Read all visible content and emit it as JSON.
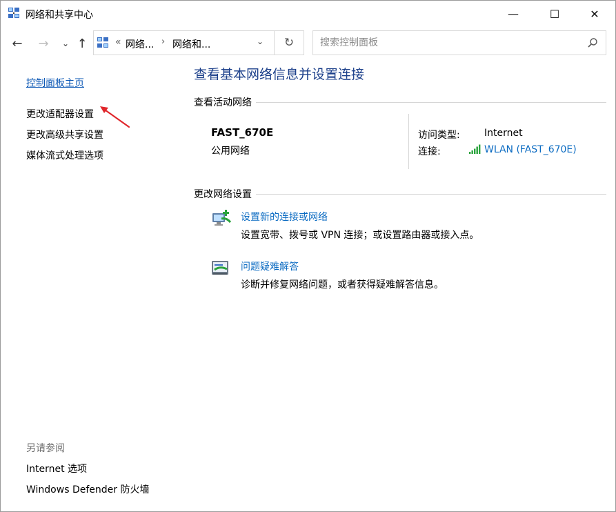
{
  "window": {
    "title": "网络和共享中心",
    "controls": {
      "minimize": "—",
      "maximize": "☐",
      "close": "✕"
    }
  },
  "nav": {
    "back": "←",
    "forward": "→",
    "recent": "⌄",
    "up": "↑",
    "breadcrumb_chevron": "«",
    "breadcrumb": [
      "网络...",
      "网络和..."
    ],
    "breadcrumb_separator": "›",
    "dropdown": "⌄",
    "refresh": "↻",
    "search_placeholder": "搜索控制面板"
  },
  "left_pane": {
    "home": "控制面板主页",
    "links": [
      "更改适配器设置",
      "更改高级共享设置",
      "媒体流式处理选项"
    ],
    "see_also_header": "另请参阅",
    "see_also": [
      "Internet 选项",
      "Windows Defender 防火墙"
    ]
  },
  "main": {
    "title": "查看基本网络信息并设置连接",
    "active_networks_header": "查看活动网络",
    "network": {
      "name": "FAST_670E",
      "type": "公用网络",
      "access_type_label": "访问类型:",
      "access_type_value": "Internet",
      "connection_label": "连接:",
      "connection_value": "WLAN (FAST_670E)"
    },
    "change_settings_header": "更改网络设置",
    "tasks": [
      {
        "title": "设置新的连接或网络",
        "description": "设置宽带、拨号或 VPN 连接；或设置路由器或接入点。"
      },
      {
        "title": "问题疑难解答",
        "description": "诊断并修复网络问题，或者获得疑难解答信息。"
      }
    ]
  },
  "colors": {
    "link": "#0b6bc2",
    "title_blue": "#1b3f8a",
    "annotation_arrow": "#e0262b",
    "signal_green": "#2aa33c"
  },
  "icons": {
    "app": "network-center-icon",
    "search": "search-icon",
    "wifi": "wifi-signal-icon",
    "task_new_connection": "new-connection-icon",
    "task_troubleshoot": "troubleshoot-icon"
  }
}
